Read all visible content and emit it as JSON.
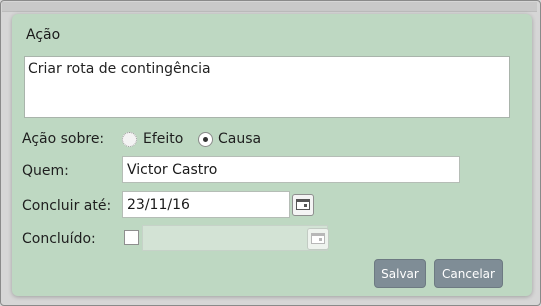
{
  "dialog": {
    "title": "Ação",
    "action_text": "Criar rota de contingência"
  },
  "form": {
    "acao_sobre_label": "Ação sobre:",
    "options": [
      {
        "label": "Efeito",
        "selected": false
      },
      {
        "label": "Causa",
        "selected": true
      }
    ],
    "quem_label": "Quem:",
    "quem_value": "Victor Castro",
    "concluir_label": "Concluir até:",
    "concluir_value": "23/11/16",
    "concluido_label": "Concluído:",
    "concluido_checked": false,
    "concluido_date": ""
  },
  "buttons": {
    "save": "Salvar",
    "cancel": "Cancelar"
  },
  "colors": {
    "dialog_bg": "#bed8c2",
    "button_bg": "#7f8d96"
  },
  "icons": {
    "calendar": "calendar-icon",
    "background_chevron": "chevron-down-icon"
  }
}
